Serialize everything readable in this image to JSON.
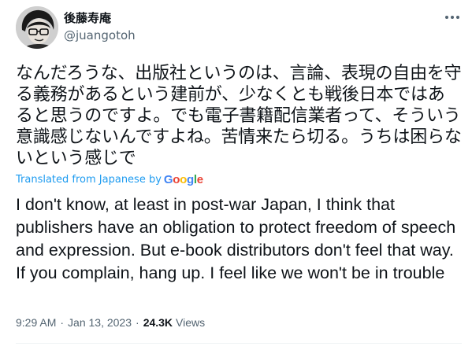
{
  "author": {
    "display_name": "後藤寿庵",
    "handle": "@juangotoh",
    "avatar_icon": "avatar-illustration-icon"
  },
  "tweet": {
    "text_original": "なんだろうな、出版社というのは、言論、表現の自由を守る義務があるという建前が、少なくとも戦後日本ではあると思うのですよ。でも電子書籍配信業者って、そういう意識感じないんですよね。苦情来たら切る。うちは困らないという感じで",
    "translated_label": "Translated from Japanese by",
    "translation_provider": "Google",
    "text_translated": "I don't know, at least in post-war Japan, I think that publishers have an obligation to protect freedom of speech and expression. But e-book distributors don't feel that way. If you complain, hang up. I feel like we won't be in trouble",
    "time": "9:29 AM",
    "separator": "·",
    "date": "Jan 13, 2023",
    "views_count": "24.3K",
    "views_label": "Views"
  },
  "colors": {
    "text": "#0f1419",
    "secondary": "#536471",
    "link": "#1d9bf0"
  },
  "icons": {
    "more": "more-options-icon"
  }
}
